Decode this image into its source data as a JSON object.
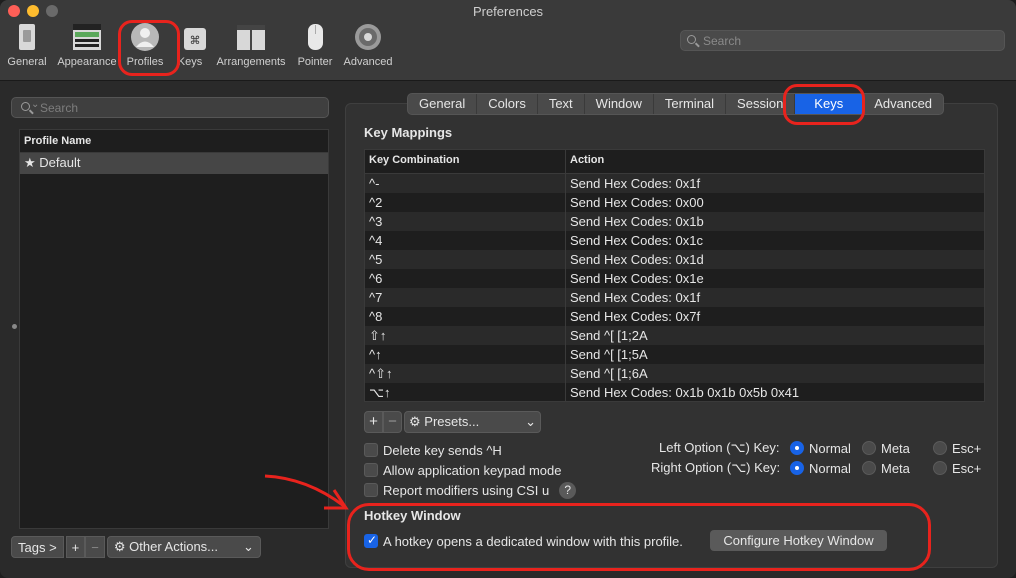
{
  "window": {
    "title": "Preferences"
  },
  "toolbar": {
    "items": [
      {
        "label": "General",
        "icon": "general-icon"
      },
      {
        "label": "Appearance",
        "icon": "appearance-icon"
      },
      {
        "label": "Profiles",
        "icon": "profiles-icon"
      },
      {
        "label": "Keys",
        "icon": "keys-icon"
      },
      {
        "label": "Arrangements",
        "icon": "arrangements-icon"
      },
      {
        "label": "Pointer",
        "icon": "pointer-icon"
      },
      {
        "label": "Advanced",
        "icon": "gear-icon"
      }
    ],
    "search_placeholder": "Search"
  },
  "sidebar": {
    "search_placeholder": "Search",
    "column_header": "Profile Name",
    "profiles": [
      {
        "star": "★",
        "name": "Default"
      }
    ],
    "tags_button": "Tags >",
    "add_button": "+",
    "remove_button": "−",
    "other_actions": "Other Actions...",
    "chevron": "⌄"
  },
  "tabs": [
    "General",
    "Colors",
    "Text",
    "Window",
    "Terminal",
    "Session",
    "Keys",
    "Advanced"
  ],
  "key_mappings": {
    "title": "Key Mappings",
    "headers": {
      "combo": "Key Combination",
      "action": "Action"
    },
    "rows": [
      {
        "combo": "^-",
        "action": "Send Hex Codes: 0x1f"
      },
      {
        "combo": "^2",
        "action": "Send Hex Codes: 0x00"
      },
      {
        "combo": "^3",
        "action": "Send Hex Codes: 0x1b"
      },
      {
        "combo": "^4",
        "action": "Send Hex Codes: 0x1c"
      },
      {
        "combo": "^5",
        "action": "Send Hex Codes: 0x1d"
      },
      {
        "combo": "^6",
        "action": "Send Hex Codes: 0x1e"
      },
      {
        "combo": "^7",
        "action": "Send Hex Codes: 0x1f"
      },
      {
        "combo": "^8",
        "action": "Send Hex Codes: 0x7f"
      },
      {
        "combo": "⇧↑",
        "action": "Send ^[ [1;2A"
      },
      {
        "combo": "^↑",
        "action": "Send ^[ [1;5A"
      },
      {
        "combo": "^⇧↑",
        "action": "Send ^[ [1;6A"
      },
      {
        "combo": "⌥↑",
        "action": "Send Hex Codes: 0x1b 0x1b 0x5b 0x41"
      }
    ],
    "add_button": "+",
    "remove_button": "−",
    "presets_label": "Presets...",
    "chevron": "⌄"
  },
  "options": {
    "delete_key": "Delete key sends ^H",
    "keypad_mode": "Allow application keypad mode",
    "csi_u": "Report modifiers using CSI u",
    "help": "?",
    "left_option_label": "Left Option (⌥) Key:",
    "right_option_label": "Right Option (⌥) Key:",
    "choices": [
      "Normal",
      "Meta",
      "Esc+"
    ],
    "left_selected": "Normal",
    "right_selected": "Normal"
  },
  "hotkey": {
    "title": "Hotkey Window",
    "checkbox_label": "A hotkey opens a dedicated window with this profile.",
    "checked": true,
    "configure_button": "Configure Hotkey Window"
  },
  "colors": {
    "accent": "#1863e6",
    "annotation": "#e8231d"
  }
}
